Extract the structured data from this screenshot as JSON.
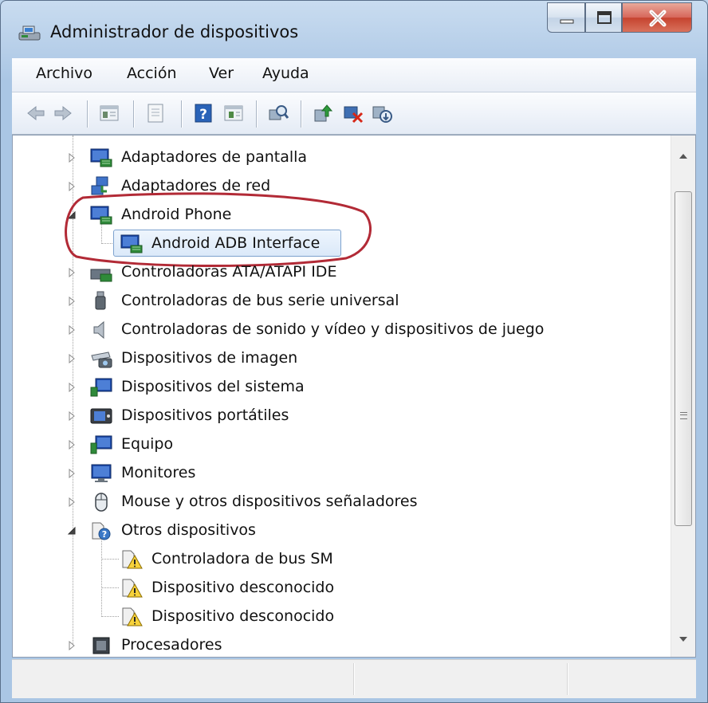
{
  "window": {
    "title": "Administrador de dispositivos"
  },
  "menu": [
    "Archivo",
    "Acción",
    "Ver",
    "Ayuda"
  ],
  "toolbar": [
    "back-icon",
    "forward-icon",
    "properties-grid-icon",
    "help-panel-icon",
    "help-icon",
    "console-icon",
    "scan-hardware-icon",
    "update-driver-icon",
    "disable-device-icon",
    "uninstall-device-icon"
  ],
  "tree": [
    {
      "label": "Adaptadores de pantalla",
      "icon": "display-adapter-icon",
      "state": "collapsed"
    },
    {
      "label": "Adaptadores de red",
      "icon": "network-adapter-icon",
      "state": "collapsed"
    },
    {
      "label": "Android Phone",
      "icon": "android-phone-icon",
      "state": "expanded"
    },
    {
      "label": "Android ADB Interface",
      "icon": "adb-interface-icon",
      "state": "child-selected"
    },
    {
      "label": "Controladoras ATA/ATAPI IDE",
      "icon": "ide-controller-icon",
      "state": "collapsed"
    },
    {
      "label": "Controladoras de bus serie universal",
      "icon": "usb-controller-icon",
      "state": "collapsed"
    },
    {
      "label": "Controladoras de sonido y vídeo y dispositivos de juego",
      "icon": "sound-icon",
      "state": "collapsed"
    },
    {
      "label": "Dispositivos de imagen",
      "icon": "imaging-device-icon",
      "state": "collapsed"
    },
    {
      "label": "Dispositivos del sistema",
      "icon": "system-device-icon",
      "state": "collapsed"
    },
    {
      "label": "Dispositivos portátiles",
      "icon": "portable-device-icon",
      "state": "collapsed"
    },
    {
      "label": "Equipo",
      "icon": "computer-icon",
      "state": "collapsed"
    },
    {
      "label": "Monitores",
      "icon": "monitor-icon",
      "state": "collapsed"
    },
    {
      "label": "Mouse y otros dispositivos señaladores",
      "icon": "mouse-icon",
      "state": "collapsed"
    },
    {
      "label": "Otros dispositivos",
      "icon": "other-devices-icon",
      "state": "expanded"
    },
    {
      "label": "Controladora de bus SM",
      "icon": "unknown-device-warning-icon",
      "state": "child"
    },
    {
      "label": "Dispositivo desconocido",
      "icon": "unknown-device-warning-icon",
      "state": "child"
    },
    {
      "label": "Dispositivo desconocido",
      "icon": "unknown-device-warning-icon",
      "state": "child"
    },
    {
      "label": "Procesadores",
      "icon": "processor-icon",
      "state": "collapsed"
    }
  ],
  "colors": {
    "highlight_oval": "#b22a36",
    "selection": "#dbe9f9",
    "window_frame": "#b9d1ea"
  }
}
